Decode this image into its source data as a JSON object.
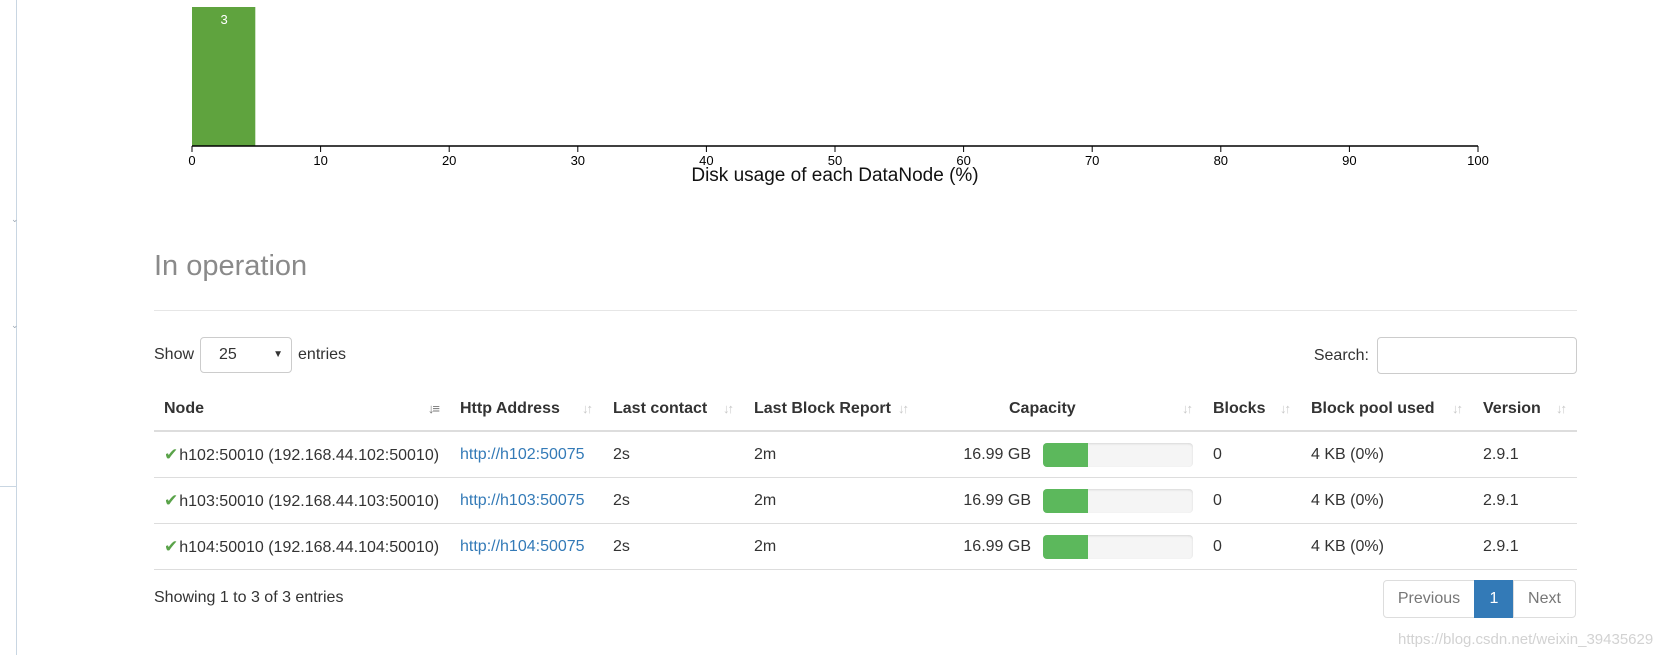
{
  "chart_data": {
    "type": "bar",
    "xlabel": "Disk usage of each DataNode (%)",
    "xticks": [
      0,
      10,
      20,
      30,
      40,
      50,
      60,
      70,
      80,
      90,
      100
    ],
    "xlim": [
      0,
      100
    ],
    "bins": [
      {
        "x0": 0,
        "x1": 5,
        "count": 3,
        "label": "3"
      }
    ],
    "bar_color": "#5fa33e"
  },
  "section": {
    "title": "In operation"
  },
  "length_control": {
    "show_label": "Show",
    "selected": "25",
    "entries_label": "entries"
  },
  "search": {
    "label": "Search:",
    "value": ""
  },
  "table": {
    "columns": [
      "Node",
      "Http Address",
      "Last contact",
      "Last Block Report",
      "Capacity",
      "Blocks",
      "Block pool used",
      "Version"
    ],
    "rows": [
      {
        "node": "h102:50010 (192.168.44.102:50010)",
        "http": "http://h102:50075",
        "last_contact": "2s",
        "last_block_report": "2m",
        "capacity": "16.99 GB",
        "capacity_used_fraction": 0.3,
        "blocks": "0",
        "block_pool_used": "4 KB (0%)",
        "version": "2.9.1"
      },
      {
        "node": "h103:50010 (192.168.44.103:50010)",
        "http": "http://h103:50075",
        "last_contact": "2s",
        "last_block_report": "2m",
        "capacity": "16.99 GB",
        "capacity_used_fraction": 0.3,
        "blocks": "0",
        "block_pool_used": "4 KB (0%)",
        "version": "2.9.1"
      },
      {
        "node": "h104:50010 (192.168.44.104:50010)",
        "http": "http://h104:50075",
        "last_contact": "2s",
        "last_block_report": "2m",
        "capacity": "16.99 GB",
        "capacity_used_fraction": 0.3,
        "blocks": "0",
        "block_pool_used": "4 KB (0%)",
        "version": "2.9.1"
      }
    ]
  },
  "footer": {
    "info": "Showing 1 to 3 of 3 entries",
    "previous": "Previous",
    "current_page": "1",
    "next": "Next"
  },
  "watermark": "https://blog.csdn.net/weixin_39435629",
  "colors": {
    "link": "#337ab7",
    "success": "#5cb85c",
    "check": "#5aa34a"
  },
  "icons": {
    "status": "check-icon",
    "sort_active": "sort-asc-icon",
    "sort": "sort-both-icon",
    "select_caret": "caret-down-icon"
  }
}
